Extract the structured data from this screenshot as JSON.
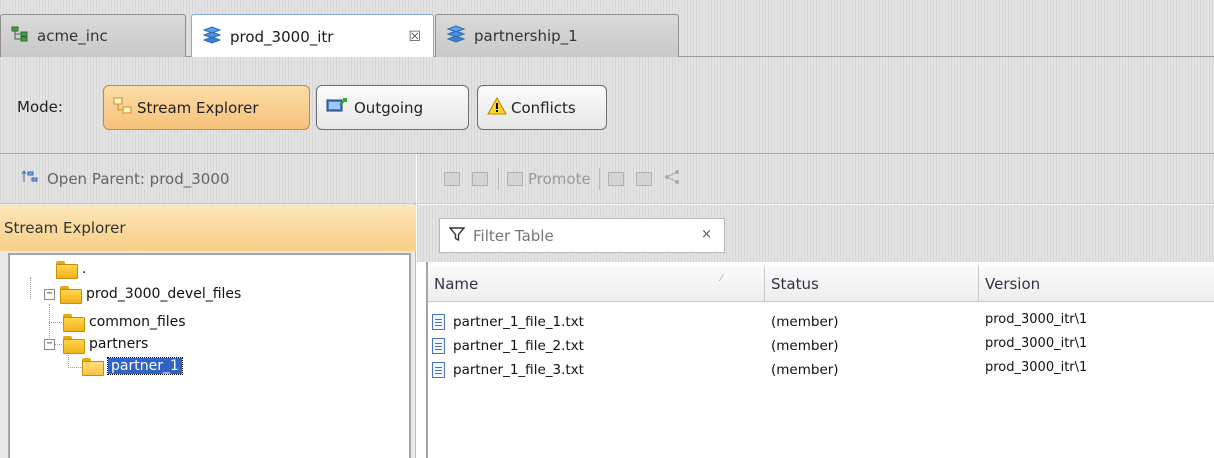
{
  "tabs": [
    {
      "label": "acme_inc",
      "icon": "workspace-icon",
      "active": false
    },
    {
      "label": "prod_3000_itr",
      "icon": "stream-icon",
      "active": true,
      "close_glyph": "☒"
    },
    {
      "label": "partnership_1",
      "icon": "stream-icon",
      "active": false
    }
  ],
  "mode": {
    "label": "Mode:",
    "buttons": [
      {
        "label": "Stream Explorer",
        "icon": "stream-explorer-icon",
        "selected": true
      },
      {
        "label": "Outgoing",
        "icon": "outgoing-icon",
        "selected": false
      },
      {
        "label": "Conflicts",
        "icon": "warning-icon",
        "selected": false
      }
    ]
  },
  "left": {
    "open_parent": "Open Parent:  prod_3000",
    "explorer_title": "Stream Explorer",
    "tree": [
      {
        "label": ".",
        "level": 0
      },
      {
        "label": "prod_3000_devel_files",
        "level": 1,
        "expanded": true
      },
      {
        "label": "common_files",
        "level": 2
      },
      {
        "label": "partners",
        "level": 2,
        "expanded": true
      },
      {
        "label": "partner_1",
        "level": 3,
        "selected": true
      }
    ]
  },
  "toolbar": {
    "promote_label": "Promote"
  },
  "filter": {
    "placeholder": "Filter Table",
    "clear_glyph": "×"
  },
  "table": {
    "columns": [
      "Name",
      "Status",
      "Version"
    ],
    "rows": [
      {
        "name": "partner_1_file_1.txt",
        "status": "(member)",
        "version": "prod_3000_itr\\1"
      },
      {
        "name": "partner_1_file_2.txt",
        "status": "(member)",
        "version": "prod_3000_itr\\1"
      },
      {
        "name": "partner_1_file_3.txt",
        "status": "(member)",
        "version": "prod_3000_itr\\1"
      }
    ]
  },
  "colors": {
    "accent_orange": "#f8cf86",
    "selection_blue": "#3162c8",
    "active_tab_border": "#8aa9d2"
  }
}
